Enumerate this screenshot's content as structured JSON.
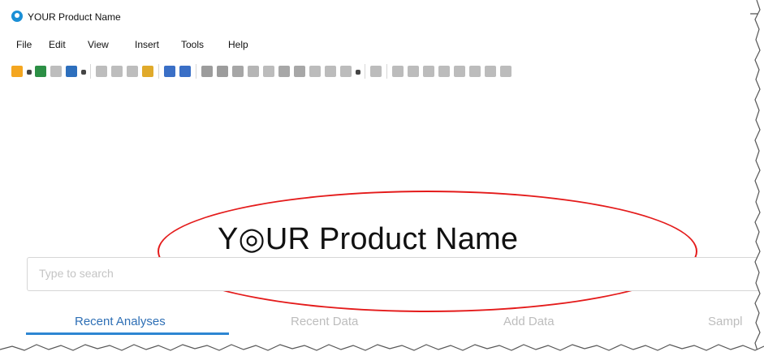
{
  "window": {
    "title": "YOUR Product Name",
    "minimize": "–"
  },
  "menubar": [
    "File",
    "Edit",
    "View",
    "Insert",
    "Tools",
    "Help"
  ],
  "toolbar": {
    "icons": [
      "open-folder-icon",
      "dropdown-icon",
      "import-icon",
      "copy-icon",
      "save-icon",
      "dropdown-icon",
      "print-icon",
      "export-icon",
      "paste-icon",
      "paste-special-icon",
      "undo-icon",
      "redo-icon",
      "reset-icon",
      "filter-icon",
      "sort-icon",
      "marker-icon",
      "tag-icon",
      "table-icon",
      "data-panel-icon",
      "grid-icon",
      "list-icon",
      "palette-icon",
      "dropdown-icon",
      "export-image-icon",
      "bulb-icon",
      "details-icon",
      "tree-icon",
      "page-icon",
      "bar-chart-icon",
      "column-chart-icon",
      "line-chart-icon",
      "combo-chart-icon"
    ],
    "colors": [
      "#f4a620",
      "#444",
      "#2c8f45",
      "#bdbdbd",
      "#2d6fbd",
      "#444",
      "#bdbdbd",
      "#bdbdbd",
      "#bdbdbd",
      "#e0aa2b",
      "#3a6fc6",
      "#3a6fc6",
      "#9c9c9c",
      "#9c9c9c",
      "#a6a6a6",
      "#b5b5b5",
      "#bcbcbc",
      "#a7a7a7",
      "#a7a7a7",
      "#bcbcbc",
      "#bcbcbc",
      "#bcbcbc",
      "#444",
      "#bcbcbc",
      "#bcbcbc",
      "#bcbcbc",
      "#bcbcbc",
      "#bcbcbc",
      "#bcbcbc",
      "#bcbcbc",
      "#bcbcbc",
      "#bcbcbc"
    ]
  },
  "brand": {
    "text": "Y◎UR Product Name",
    "highlight_color": "#e41b1b"
  },
  "search": {
    "placeholder": "Type to search"
  },
  "tabs": [
    {
      "label": "Recent Analyses",
      "active": true
    },
    {
      "label": "Recent Data",
      "active": false
    },
    {
      "label": "Add Data",
      "active": false
    },
    {
      "label": "Sampl",
      "active": false
    }
  ],
  "accent_color": "#2d86d2"
}
